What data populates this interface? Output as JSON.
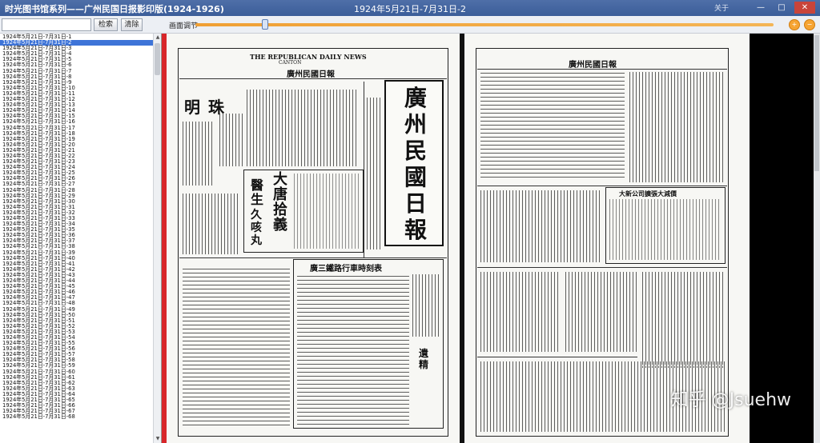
{
  "app": {
    "title": "时光图书馆系列——广州民国日报影印版(1924-1926)",
    "document_title": "1924年5月21日-7月31日-2",
    "about": "关于",
    "controls": {
      "minimize": "—",
      "maximize": "□",
      "close": "✕"
    }
  },
  "toolbar": {
    "search_value": "",
    "search_button": "检索",
    "clear_button": "清除",
    "brightness_label": "画面调节",
    "brightness_level": 0.12,
    "zoom_in_icon": "zoom-in-icon",
    "zoom_out_icon": "zoom-out-icon"
  },
  "file_list": {
    "selected_index": 1,
    "items": [
      "1924年5月21日-7月31日-1",
      "1924年5月21日-7月31日-2",
      "1924年5月21日-7月31日-3",
      "1924年5月21日-7月31日-4",
      "1924年5月21日-7月31日-5",
      "1924年5月21日-7月31日-6",
      "1924年5月21日-7月31日-7",
      "1924年5月21日-7月31日-8",
      "1924年5月21日-7月31日-9",
      "1924年5月21日-7月31日-10",
      "1924年5月21日-7月31日-11",
      "1924年5月21日-7月31日-12",
      "1924年5月21日-7月31日-13",
      "1924年5月21日-7月31日-14",
      "1924年5月21日-7月31日-15",
      "1924年5月21日-7月31日-16",
      "1924年5月21日-7月31日-17",
      "1924年5月21日-7月31日-18",
      "1924年5月21日-7月31日-19",
      "1924年5月21日-7月31日-20",
      "1924年5月21日-7月31日-21",
      "1924年5月21日-7月31日-22",
      "1924年5月21日-7月31日-23",
      "1924年5月21日-7月31日-24",
      "1924年5月21日-7月31日-25",
      "1924年5月21日-7月31日-26",
      "1924年5月21日-7月31日-27",
      "1924年5月21日-7月31日-28",
      "1924年5月21日-7月31日-29",
      "1924年5月21日-7月31日-30",
      "1924年5月21日-7月31日-31",
      "1924年5月21日-7月31日-32",
      "1924年5月21日-7月31日-33",
      "1924年5月21日-7月31日-34",
      "1924年5月21日-7月31日-35",
      "1924年5月21日-7月31日-36",
      "1924年5月21日-7月31日-37",
      "1924年5月21日-7月31日-38",
      "1924年5月21日-7月31日-39",
      "1924年5月21日-7月31日-40",
      "1924年5月21日-7月31日-41",
      "1924年5月21日-7月31日-42",
      "1924年5月21日-7月31日-43",
      "1924年5月21日-7月31日-44",
      "1924年5月21日-7月31日-45",
      "1924年5月21日-7月31日-46",
      "1924年5月21日-7月31日-47",
      "1924年5月21日-7月31日-48",
      "1924年5月21日-7月31日-49",
      "1924年5月21日-7月31日-50",
      "1924年5月21日-7月31日-51",
      "1924年5月21日-7月31日-52",
      "1924年5月21日-7月31日-53",
      "1924年5月21日-7月31日-54",
      "1924年5月21日-7月31日-55",
      "1924年5月21日-7月31日-56",
      "1924年5月21日-7月31日-57",
      "1924年5月21日-7月31日-58",
      "1924年5月21日-7月31日-59",
      "1924年5月21日-7月31日-60",
      "1924年5月21日-7月31日-61",
      "1924年5月21日-7月31日-62",
      "1924年5月21日-7月31日-63",
      "1924年5月21日-7月31日-64",
      "1924年5月21日-7月31日-65",
      "1924年5月21日-7月31日-66",
      "1924年5月21日-7月31日-67",
      "1924年5月21日-7月31日-68"
    ]
  },
  "newspaper": {
    "english_title": "THE REPUBLICAN DAILY NEWS",
    "english_city": "CANTON",
    "header_line": "廣州民國日報",
    "masthead": [
      "廣",
      "州",
      "民",
      "國",
      "日",
      "報"
    ],
    "ad_mingzhu": "明珠",
    "ad_medicine": "大唐拾義",
    "ad_medicine_sub": "醫生",
    "ad_medicine_sub2": "久咳丸",
    "railway_table_title": "廣三鐵路行車時刻表",
    "right_page_notice": "大新公司擴張大減價",
    "right_page_box": "遺精"
  },
  "watermark": "知乎 @Jsuehw"
}
